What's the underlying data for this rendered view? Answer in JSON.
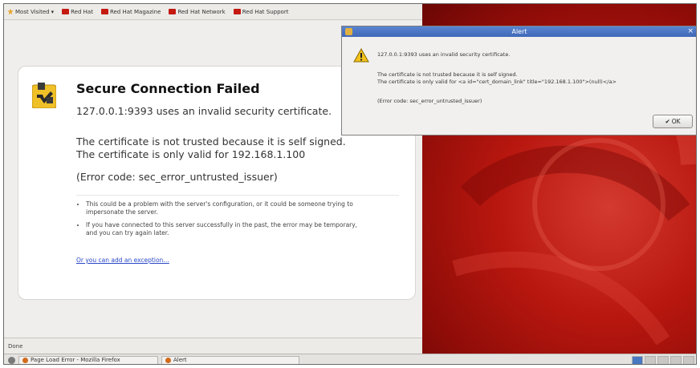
{
  "bookmarks": [
    "Most Visited",
    "Red Hat",
    "Red Hat Magazine",
    "Red Hat Network",
    "Red Hat Support"
  ],
  "error_page": {
    "title": "Secure Connection Failed",
    "line1": "127.0.0.1:9393 uses an invalid security certificate.",
    "line2": "The certificate is not trusted because it is self signed.",
    "line3": "The certificate is only valid for 192.168.1.100",
    "error_code": "(Error code: sec_error_untrusted_issuer)",
    "bullet1": "This could be a problem with the server's configuration, or it could be someone trying to impersonate the server.",
    "bullet2": "If you have connected to this server successfully in the past, the error may be temporary, and you can try again later.",
    "exception_link": "Or you can add an exception…"
  },
  "status_bar": {
    "text": "Done"
  },
  "taskbar": {
    "firefox_label": "Page Load Error - Mozilla Firefox",
    "alert_label": "Alert"
  },
  "alert_dialog": {
    "title": "Alert",
    "close": "×",
    "line1": "127.0.0.1:9393 uses an invalid security certificate.",
    "line2": "The certificate is not trusted because it is self signed.",
    "line3": "The certificate is only valid for <a id=\"cert_domain_link\" title=\"192.168.1.100\">(null)</a>",
    "line4": "(Error code: sec_error_untrusted_issuer)",
    "ok_label": "OK"
  }
}
